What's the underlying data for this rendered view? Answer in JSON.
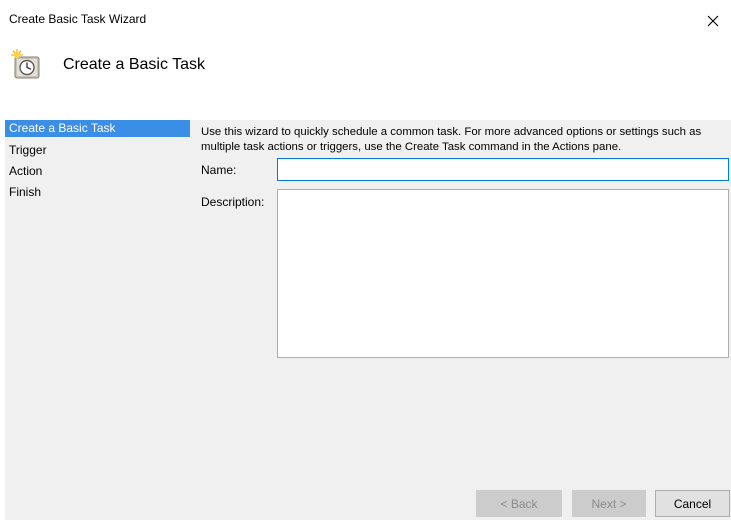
{
  "window": {
    "title": "Create Basic Task Wizard",
    "close_icon": "close-icon"
  },
  "header": {
    "title": "Create a Basic Task",
    "icon": "scheduled-task-clock-icon"
  },
  "sidebar": {
    "items": [
      {
        "label": "Create a Basic Task",
        "active": true
      },
      {
        "label": "Trigger",
        "active": false
      },
      {
        "label": "Action",
        "active": false
      },
      {
        "label": "Finish",
        "active": false
      }
    ]
  },
  "main": {
    "intro": "Use this wizard to quickly schedule a common task.  For more advanced options or settings such as multiple task actions or triggers, use the Create Task command in the Actions pane.",
    "name_label": "Name:",
    "name_value": "",
    "description_label": "Description:",
    "description_value": ""
  },
  "buttons": {
    "back": "< Back",
    "next": "Next >",
    "cancel": "Cancel"
  },
  "colors": {
    "accent": "#3a8ee6",
    "focus_border": "#0078d7",
    "panel_background": "#f0f0f0",
    "disabled_button": "#cccccc"
  }
}
